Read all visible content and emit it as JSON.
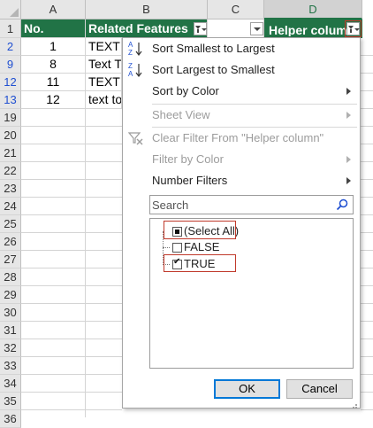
{
  "columns": [
    "A",
    "B",
    "C",
    "D"
  ],
  "rows": [
    "1",
    "2",
    "9",
    "12",
    "13",
    "19",
    "20",
    "21",
    "22",
    "23",
    "24",
    "25",
    "26",
    "27",
    "28",
    "29",
    "30",
    "31",
    "32",
    "33",
    "34",
    "35",
    "36"
  ],
  "header": {
    "a": "No.",
    "b": "Related Features",
    "c": "",
    "d": "Helper column"
  },
  "data": [
    {
      "no": "1",
      "text": "TEXT T"
    },
    {
      "no": "8",
      "text": "Text To"
    },
    {
      "no": "11",
      "text": "TEXT T"
    },
    {
      "no": "12",
      "text": "text to"
    }
  ],
  "menu": {
    "sort_asc": "Sort Smallest to Largest",
    "sort_desc": "Sort Largest to Smallest",
    "sort_color": "Sort by Color",
    "sheet_view": "Sheet View",
    "clear_filter": "Clear Filter From \"Helper column\"",
    "filter_color": "Filter by Color",
    "number_filters": "Number Filters",
    "search_placeholder": "Search",
    "select_all": "(Select All)",
    "false_label": "FALSE",
    "true_label": "TRUE",
    "ok": "OK",
    "cancel": "Cancel"
  },
  "icons": {
    "sort_asc": "sort-ascending-icon",
    "sort_desc": "sort-descending-icon",
    "clear_filter": "clear-filter-icon",
    "search": "search-icon"
  },
  "colors": {
    "header_green": "#217346",
    "highlight_red": "#c0392b",
    "row_blue": "#1f4fd1"
  }
}
